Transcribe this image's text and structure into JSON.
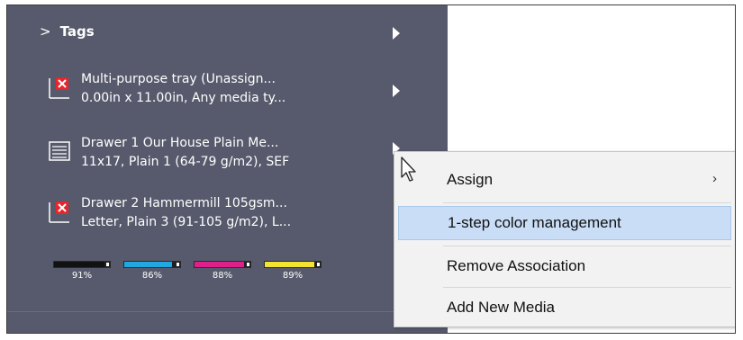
{
  "sidebar": {
    "tags_label": "Tags",
    "items": [
      {
        "line1": "Multi-purpose tray (Unassign...",
        "line2": "0.00in x 11.00in, Any media ty...",
        "icon": "unassigned-error-icon"
      },
      {
        "line1": "Drawer 1 Our House Plain Me...",
        "line2": "11x17, Plain 1 (64-79 g/m2), SEF",
        "icon": "paper-drawer-icon"
      },
      {
        "line1": "Drawer 2 Hammermill 105gsm...",
        "line2": "Letter, Plain 3 (91-105 g/m2), L...",
        "icon": "unassigned-error-icon"
      }
    ],
    "ink_levels": [
      {
        "name": "black",
        "percent_label": "91%",
        "level": 0.91,
        "color": "#111111"
      },
      {
        "name": "cyan",
        "percent_label": "86%",
        "level": 0.86,
        "color": "#21a8e0"
      },
      {
        "name": "magenta",
        "percent_label": "88%",
        "level": 0.88,
        "color": "#e0208a"
      },
      {
        "name": "yellow",
        "percent_label": "89%",
        "level": 0.89,
        "color": "#f2e531"
      }
    ]
  },
  "context_menu": {
    "items": [
      {
        "label": "Assign",
        "has_submenu": true,
        "submenu_glyph": "›"
      },
      {
        "label": "1-step color management",
        "highlighted": true
      },
      {
        "label": "Remove Association"
      },
      {
        "label": "Add New Media"
      }
    ]
  },
  "colors": {
    "panel_bg": "#575a6c",
    "menu_bg": "#f2f2f2",
    "menu_highlight": "#c9def6",
    "error_red": "#e8252b"
  }
}
